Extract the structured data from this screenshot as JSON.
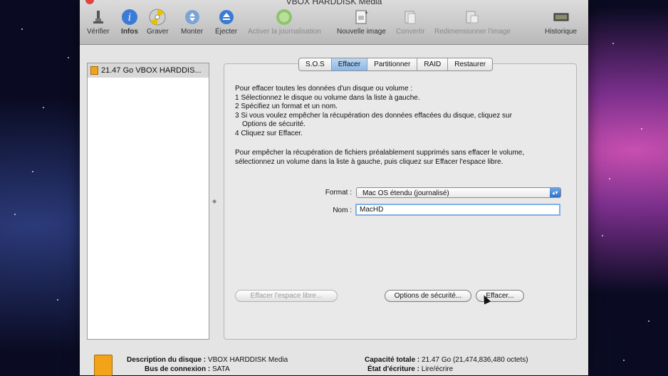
{
  "window": {
    "title": "VBOX HARDDISK Media"
  },
  "toolbar": [
    {
      "label": "Vérifier",
      "icon": "microscope-icon",
      "enabled": true
    },
    {
      "label": "Infos",
      "icon": "info-icon",
      "enabled": true
    },
    {
      "label": "Graver",
      "icon": "burn-icon",
      "enabled": true
    },
    {
      "label": "Monter",
      "icon": "mount-icon",
      "enabled": true
    },
    {
      "label": "Éjecter",
      "icon": "eject-icon",
      "enabled": true
    },
    {
      "label": "Activer la journalisation",
      "icon": "journal-icon",
      "enabled": false
    },
    {
      "label": "Nouvelle image",
      "icon": "new-image-icon",
      "enabled": true
    },
    {
      "label": "Convertir",
      "icon": "convert-icon",
      "enabled": false
    },
    {
      "label": "Redimensionner l'image",
      "icon": "resize-image-icon",
      "enabled": false
    },
    {
      "label": "Historique",
      "icon": "log-icon",
      "enabled": true
    }
  ],
  "sidebar": {
    "items": [
      {
        "label": "21.47 Go VBOX HARDDIS..."
      }
    ]
  },
  "tabs": [
    {
      "label": "S.O.S",
      "active": false
    },
    {
      "label": "Effacer",
      "active": true
    },
    {
      "label": "Partitionner",
      "active": false
    },
    {
      "label": "RAID",
      "active": false
    },
    {
      "label": "Restaurer",
      "active": false
    }
  ],
  "instructions": {
    "l1": "Pour effacer toutes les données d'un disque ou volume :",
    "l2": "1 Sélectionnez le disque ou volume dans la liste à gauche.",
    "l3": "2 Spécifiez un format et un nom.",
    "l4": "3 Si vous voulez empêcher la récupération des données effacées du disque, cliquez sur",
    "l5": "Options de sécurité.",
    "l6": "4 Cliquez sur Effacer.",
    "p2a": "Pour empêcher la récupération de fichiers préalablement supprimés sans effacer le volume,",
    "p2b": "sélectionnez un volume dans la liste à gauche, puis cliquez sur Effacer l'espace libre."
  },
  "form": {
    "format_label": "Format :",
    "format_value": "Mac OS étendu (journalisé)",
    "name_label": "Nom :",
    "name_value": "MacHD"
  },
  "buttons": {
    "erase_free_space": "Effacer l'espace libre...",
    "security_options": "Options de sécurité...",
    "erase": "Effacer..."
  },
  "info": {
    "desc_label": "Description du disque :",
    "desc_value": "VBOX HARDDISK Media",
    "bus_label": "Bus de connexion :",
    "bus_value": "SATA",
    "capacity_label": "Capacité totale :",
    "capacity_value": "21.47 Go (21,474,836,480 octets)",
    "write_label": "État d'écriture :",
    "write_value": "Lire/écrire"
  },
  "colors": {
    "accent": "#3a7bd5",
    "disk": "#f2a31a"
  }
}
